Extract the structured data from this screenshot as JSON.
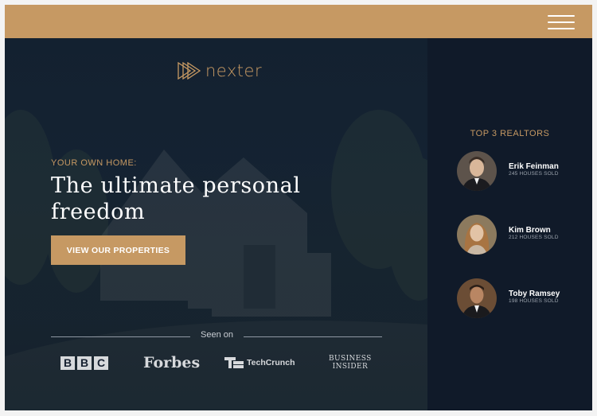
{
  "brand": {
    "name": "nexter"
  },
  "header": {
    "menu_icon": "hamburger-menu-icon"
  },
  "hero": {
    "eyebrow": "YOUR OWN HOME:",
    "headline": "The ultimate personal freedom",
    "cta_label": "VIEW OUR PROPERTIES",
    "seen_on_label": "Seen on",
    "press_logos": [
      "BBC",
      "Forbes",
      "TechCrunch",
      "Business Insider"
    ],
    "bbc_letters": [
      "B",
      "B",
      "C"
    ],
    "forbes_text": "Forbes",
    "techcrunch_text": "TechCrunch",
    "bi_line1": "BUSINESS",
    "bi_line2": "INSIDER"
  },
  "sidebar": {
    "title": "TOP 3 REALTORS",
    "realtors": [
      {
        "name": "Erik Feinman",
        "sold": "245 HOUSES SOLD"
      },
      {
        "name": "Kim Brown",
        "sold": "212 HOUSES SOLD"
      },
      {
        "name": "Toby Ramsey",
        "sold": "198 HOUSES SOLD"
      }
    ]
  },
  "colors": {
    "accent": "#c69963",
    "dark": "#101a29",
    "text_light": "#ffffff"
  }
}
